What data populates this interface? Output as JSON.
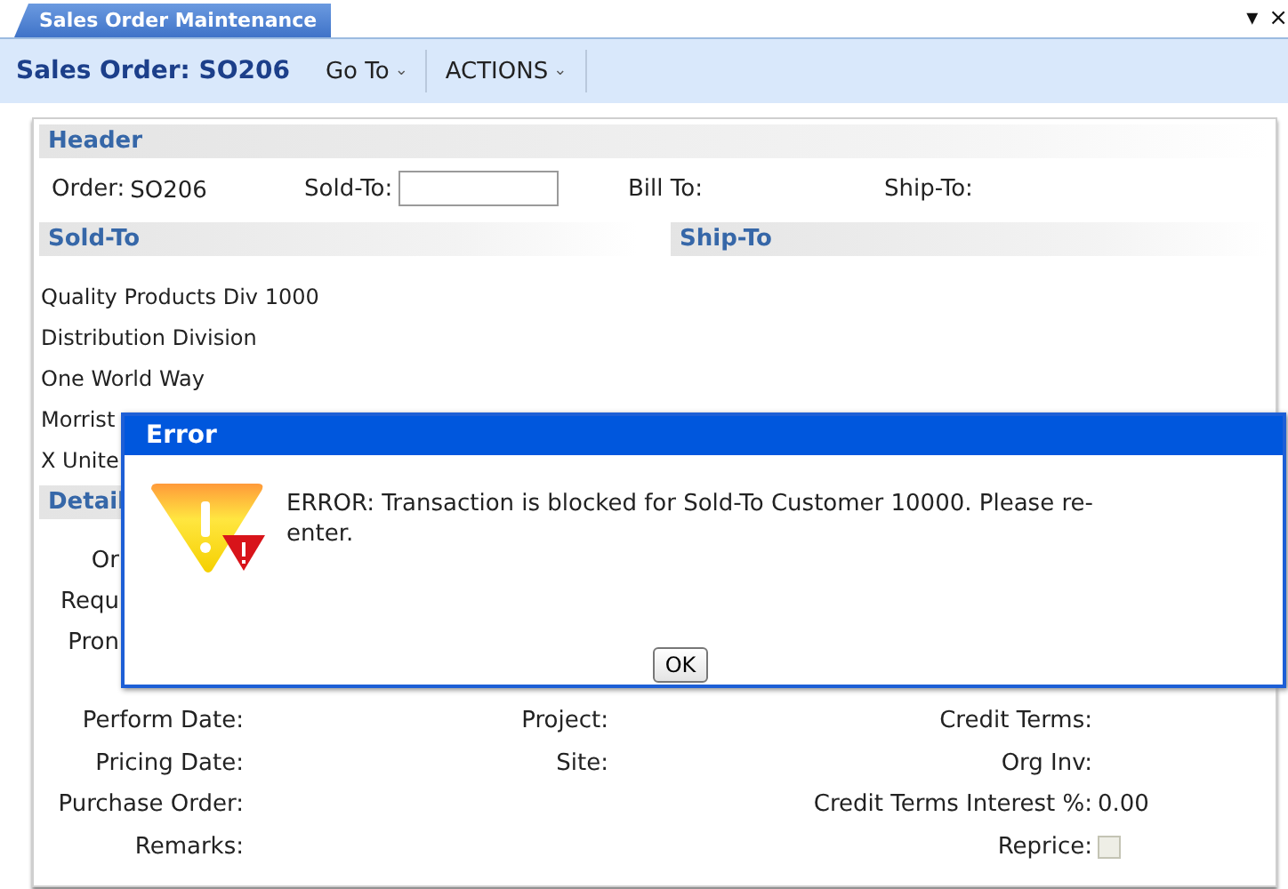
{
  "tab": {
    "label": "Sales Order Maintenance",
    "selected": true
  },
  "window_controls": {
    "menu": "▾",
    "close": "×"
  },
  "toolbar": {
    "title": "Sales Order: SO206",
    "menus": [
      {
        "label": "Go To",
        "caret": "⌄"
      },
      {
        "label": "ACTIONS",
        "caret": "⌄"
      }
    ]
  },
  "header": {
    "title": "Header",
    "order_label": "Order:",
    "order_value": "SO206",
    "sold_to_label": "Sold-To:",
    "bill_to_label": "Bill To:",
    "ship_to_label": "Ship-To:"
  },
  "sold_to": {
    "title": "Sold-To",
    "lines": [
      "Quality Products Div 1000",
      "Distribution Division",
      "One World Way",
      "Morrist",
      "X Unite"
    ]
  },
  "ship_to": {
    "title": "Ship-To"
  },
  "detail": {
    "title": "Detail",
    "covered_labels": [
      "Or",
      "Requ",
      "Pron"
    ],
    "rows": [
      {
        "left": {
          "kind": "text",
          "label": "Perform Date:"
        },
        "middle": {
          "kind": "text",
          "label": "Project:"
        },
        "right": {
          "kind": "text",
          "label": "Credit Terms:"
        }
      },
      {
        "left": {
          "kind": "text",
          "label": "Pricing Date:"
        },
        "middle": {
          "kind": "text",
          "label": "Site:"
        },
        "right": {
          "kind": "text",
          "label": "Org Inv:"
        }
      },
      {
        "left": {
          "kind": "text",
          "label": "Purchase Order:"
        },
        "right": {
          "kind": "text",
          "label": "Credit Terms Interest %:",
          "value": "0.00"
        }
      },
      {
        "left": {
          "kind": "text",
          "label": "Remarks:"
        },
        "right": {
          "kind": "checkbox",
          "label": "Reprice:",
          "checked": false,
          "disabled": true
        }
      }
    ]
  },
  "dialog": {
    "title": "Error",
    "message": "ERROR: Transaction is blocked for Sold-To Customer 10000.  Please re-enter.",
    "buttons": [
      "OK"
    ]
  }
}
